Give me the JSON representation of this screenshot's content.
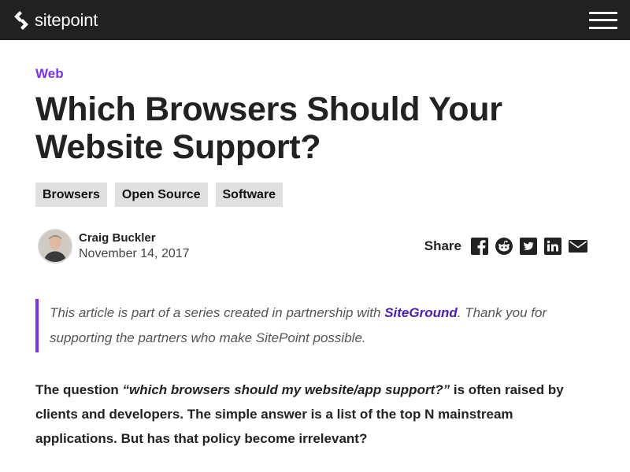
{
  "header": {
    "logo_text": "sitepoint",
    "menu_icon": "hamburger-menu-icon"
  },
  "article": {
    "category": "Web",
    "title_line1": "Which Browsers Should Your",
    "title_line2": "Website Support?",
    "tags": [
      "Browsers",
      "Open Source",
      "Software"
    ],
    "author": {
      "name": "Craig Buckler",
      "date": "November 14, 2017"
    },
    "share": {
      "label": "Share",
      "icons": [
        "facebook-icon",
        "reddit-icon",
        "twitter-icon",
        "linkedin-icon",
        "email-icon"
      ]
    },
    "callout": {
      "before": "This article is part of a series created in partnership with ",
      "link": "SiteGround",
      "after": ". Thank you for supporting the partners who make SitePoint possible."
    },
    "intro": {
      "before": "The question ",
      "quote": "“which browsers should my website/app support?”",
      "after": " is often raised by clients and developers. The simple answer is a list of the top N mainstream applications. But has that policy become irrelevant?"
    }
  },
  "colors": {
    "header_bg": "#212121",
    "accent": "#7b2ff7",
    "link": "#4a1fb8",
    "tag_bg": "#e0e0e0"
  }
}
